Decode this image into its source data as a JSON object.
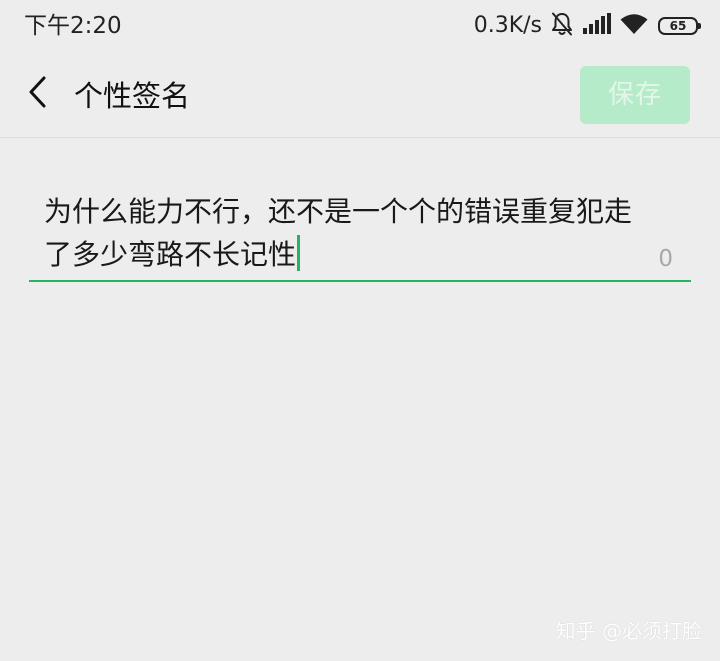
{
  "status_bar": {
    "time": "下午2:20",
    "net_speed": "0.3K/s",
    "icons": [
      "bell-mute-icon",
      "signal-icon",
      "wifi-icon",
      "battery-icon"
    ],
    "battery_level": "65"
  },
  "title_bar": {
    "back_icon": "chevron-left-icon",
    "title": "个性签名",
    "save_label": "保存"
  },
  "editor": {
    "text": "为什么能力不行，还不是一个个的错误重复犯走了多少弯路不长记性",
    "char_count": "0"
  },
  "watermark": {
    "text": "知乎 @必须打脸"
  },
  "colors": {
    "background": "#ededed",
    "accent": "#26b463",
    "save_button_bg": "#b6ebca",
    "save_button_text": "#e3f6ea"
  }
}
